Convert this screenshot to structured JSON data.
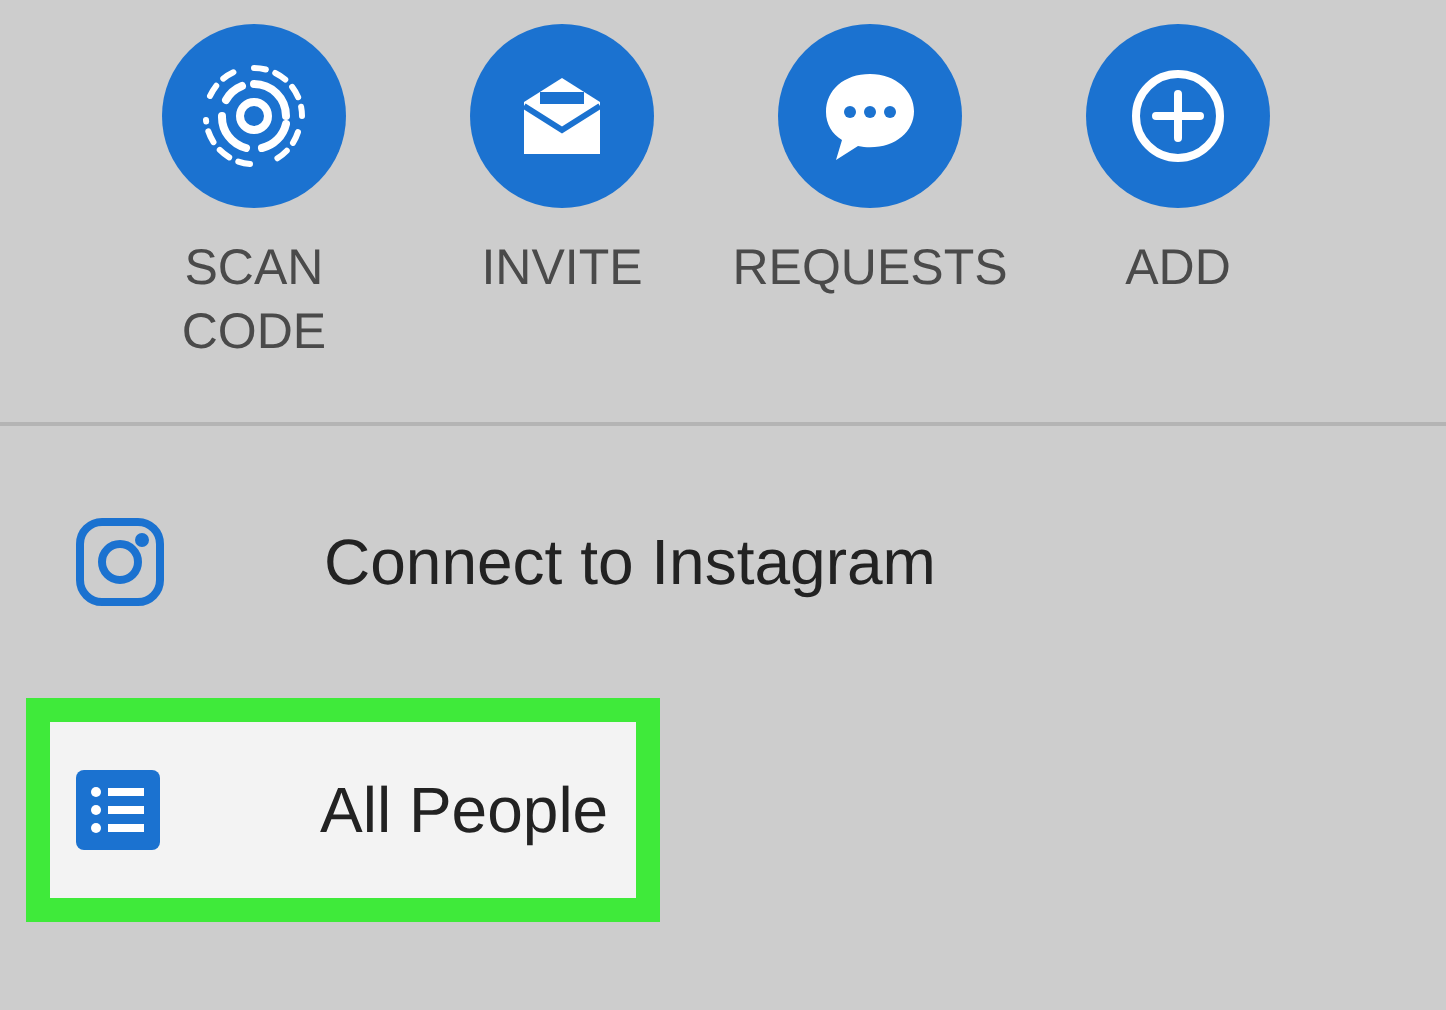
{
  "actions": [
    {
      "kind": "scan",
      "label": "SCAN\nCODE"
    },
    {
      "kind": "invite",
      "label": "INVITE"
    },
    {
      "kind": "requests",
      "label": "REQUESTS"
    },
    {
      "kind": "add",
      "label": "ADD"
    }
  ],
  "menu": [
    {
      "kind": "instagram",
      "label": "Connect to Instagram",
      "highlighted": false
    },
    {
      "kind": "list",
      "label": "All People",
      "highlighted": true
    }
  ]
}
